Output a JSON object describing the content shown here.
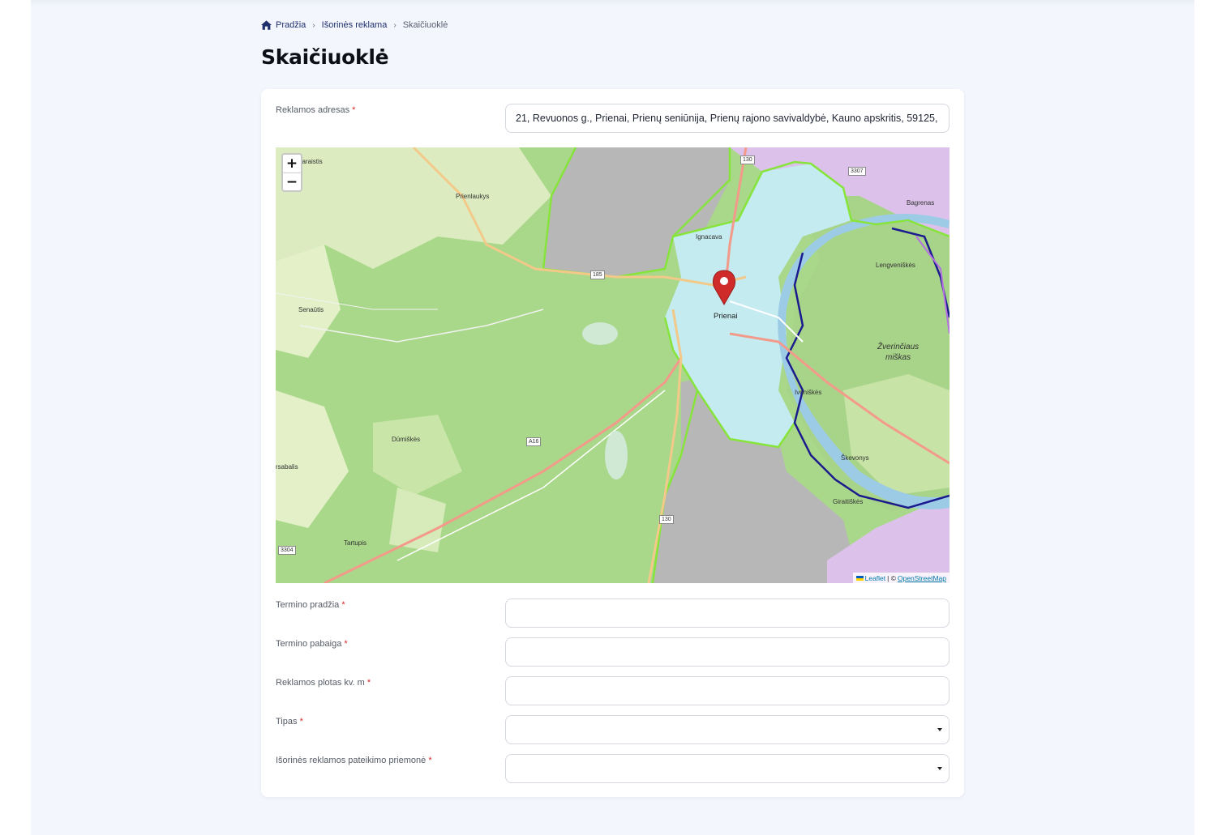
{
  "breadcrumb": {
    "home": "Pradžia",
    "section": "Išorinės reklama",
    "current": "Skaičiuoklė"
  },
  "page_title": "Skaičiuoklė",
  "form": {
    "address_label": "Reklamos adresas",
    "address_value": "21, Revuonos g., Prienai, Prienų seniūnija, Prienų rajono savivaldybė, Kauno apskritis, 59125,",
    "term_start_label": "Termino pradžia",
    "term_end_label": "Termino pabaiga",
    "area_label": "Reklamos plotas kv. m",
    "type_label": "Tipas",
    "means_label": "Išorinės reklamos pateikimo priemonė",
    "required_mark": "*"
  },
  "map": {
    "zoom_in": "+",
    "zoom_out": "−",
    "attribution_leaflet": "Leaflet",
    "attribution_sep": "| ©",
    "attribution_osm": "OpenStreetMap",
    "labels": {
      "prienai": "Prienai",
      "prienlaukys": "Prienlaukys",
      "senautis": "Senaūtis",
      "dumiskes": "Dūmiškės",
      "ignacava": "Ignacava",
      "lengveniskes": "Lengveniškės",
      "bagrenas": "Bagrenas",
      "zverinciaus": "Žverinčiaus",
      "miskas": "miškas",
      "ivoniskes": "Ivoniškės",
      "skevonys": "Škevonys",
      "giraitiskes": "Giraitiškės",
      "tartupis": "Tartupis",
      "darzistis": "daraistis",
      "rsabalis": "rsabalis"
    },
    "road_refs": {
      "r130_top": "130",
      "r3307": "3307",
      "r185": "185",
      "ra16": "A16",
      "r3304": "3304",
      "r130_bottom": "130"
    },
    "colors": {
      "forest": "#a9d88a",
      "farmland": "#e3f0c8",
      "urban": "#c4ecf0",
      "river": "#9ccbe6",
      "boundary": "#86e43a",
      "military": "#d8b8e6",
      "gray_forest": "#b5b5b5"
    }
  }
}
